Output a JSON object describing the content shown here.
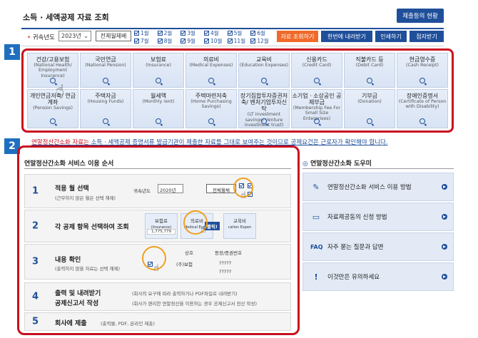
{
  "header": {
    "title": "소득 · 세액공제 자료 조회",
    "status_button": "제출등의 현황"
  },
  "toolbar": {
    "year_label": "귀속년도",
    "year_value": "2023년",
    "full_select": "전체월체배",
    "months": [
      "1월",
      "2월",
      "3월",
      "4월",
      "5월",
      "6월",
      "7월",
      "8월",
      "9월",
      "10월",
      "11월",
      "12월"
    ],
    "query_button": "자료 조회하기",
    "download_button": "한번에 내려받기",
    "print_button": "인쇄하기",
    "submit_button": "점자받기"
  },
  "step1": {
    "badge": "1",
    "categories": [
      {
        "ko": "건강/고용보험",
        "en": "(National Health/ Employment Insurance)"
      },
      {
        "ko": "국민연금",
        "en": "(National Pension)"
      },
      {
        "ko": "보험료",
        "en": "(Insurance)"
      },
      {
        "ko": "의료비",
        "en": "(Medical Expenses)"
      },
      {
        "ko": "교육비",
        "en": "(Education Expenses)"
      },
      {
        "ko": "신용카드",
        "en": "(Credit Card)"
      },
      {
        "ko": "직불카드 등",
        "en": "(Debit Card)"
      },
      {
        "ko": "현금영수증",
        "en": "(Cash Receipt)"
      },
      {
        "ko": "개인연금저축/ 연금계좌",
        "en": "(Pension Savings)"
      },
      {
        "ko": "주택자금",
        "en": "(Housing Funds)"
      },
      {
        "ko": "월세액",
        "en": "(Monthly rent)"
      },
      {
        "ko": "주택마련저축",
        "en": "(Home Purchasing Savings)"
      },
      {
        "ko": "장기집합투자증권저축/ 벤처기업투자신탁",
        "en": "(LT investment savings/ Venture investment trust)"
      },
      {
        "ko": "소기업 · 소상공인 공제부금",
        "en": "(Membership Fee For Small Size Enterprises)"
      },
      {
        "ko": "기부금",
        "en": "(Donation)"
      },
      {
        "ko": "장애인증명서",
        "en": "(Certificate of Person with Disability)"
      }
    ]
  },
  "notice": {
    "highlight": "연말정산간소화 자료는",
    "rest": " 소득 · 세액공제 증명서류 발급기관이 제출한 자료를 그대로 보여주는 것이므로 공제요건은 근로자가 확인해야 합니다."
  },
  "step2": {
    "badge": "2",
    "title": "연말정산간소화 서비스 이용 순서",
    "rows": [
      {
        "num": "1",
        "head": "적용 월 선택",
        "sub": "(근무하지 않은 월은 선택 해제)"
      },
      {
        "num": "2",
        "head": "각 공제 항목 선택하여 조회",
        "sub": ""
      },
      {
        "num": "3",
        "head": "내용 확인",
        "sub": "(출력하지 않을 자료는 선택 해제)"
      },
      {
        "num": "4",
        "head": "출력 및 내려받기",
        "head2": "공제신고서 작성",
        "sub": "(회사의 요구에 따라 출력하거나 PDF파일로 내려받기)",
        "sub2": "(회사가 편리한 연말정산을 이용하는 경우 공제신고서 전산 작성)"
      },
      {
        "num": "5",
        "head": "회사에 제출",
        "sub": "(출력물, PDF, 온라인 제출)"
      }
    ],
    "mini": {
      "year_label": "귀속년도",
      "year_value": "2020년",
      "full_btn": "전체월체",
      "insurance": "보험료",
      "insurance_en": "(Insurance)",
      "medical": "의료비",
      "medical_en": "Medical Expen",
      "click": "클릭!",
      "education": "교육비",
      "education_en": "cation Expen",
      "amount": "1,775,779",
      "col_trade": "상호",
      "col_reg": "등장/증권번호",
      "row1": "(주)보험",
      "row1_val": "?????",
      "row2_val": "?????"
    }
  },
  "sidebar": {
    "title": "연말정산간소화 도우미",
    "items": [
      {
        "icon": "✎",
        "label": "연말정산간소화 서비스 이용 방법"
      },
      {
        "icon": "▭",
        "label": "자료제공동의 신청 방법"
      },
      {
        "icon": "FAQ",
        "label": "자주 묻는 질문과 답변"
      },
      {
        "icon": "!",
        "label": "이것만은 유의하세요"
      }
    ]
  },
  "colors": {
    "accent": "#1f4f9a",
    "highlight": "#c81020",
    "orange": "#f06a2a"
  }
}
